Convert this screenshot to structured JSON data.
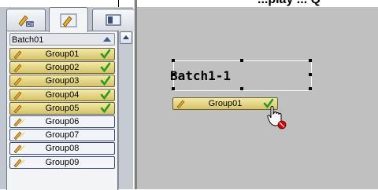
{
  "header": {
    "cut_text": "...play ... Q"
  },
  "tabs": [
    {
      "name": "channel-tab",
      "icon": "ch-icon"
    },
    {
      "name": "group-tab",
      "icon": "group-icon",
      "active": true
    },
    {
      "name": "layout-tab",
      "icon": "layout-icon"
    }
  ],
  "list": {
    "batch_label": "Batch01",
    "items": [
      {
        "label": "Group01",
        "on": true
      },
      {
        "label": "Group02",
        "on": true
      },
      {
        "label": "Group03",
        "on": true
      },
      {
        "label": "Group04",
        "on": true
      },
      {
        "label": "Group05",
        "on": true
      },
      {
        "label": "Group06",
        "on": false
      },
      {
        "label": "Group07",
        "on": false
      },
      {
        "label": "Group08",
        "on": false
      },
      {
        "label": "Group09",
        "on": false
      }
    ]
  },
  "canvas": {
    "batch_title": "Batch1-1",
    "dragged_item": "Group01"
  },
  "colors": {
    "active_row": "#d5c36a",
    "check": "#2e9a1d",
    "panel": "#c0c7d1",
    "canvas": "#c0c0c0"
  }
}
